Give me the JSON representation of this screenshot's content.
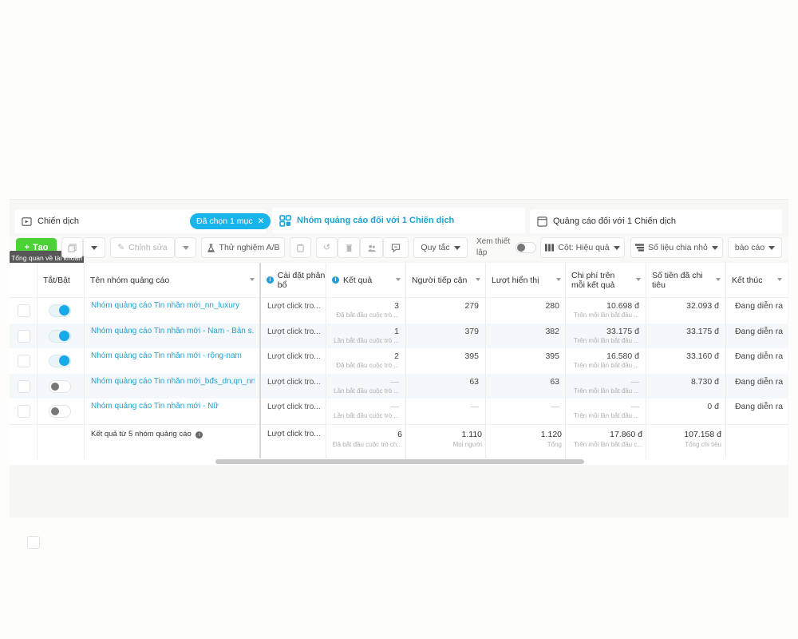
{
  "tabs": {
    "campaigns": "Chiến dịch",
    "selected_pill": "Đã chọn 1 mục",
    "adsets": "Nhóm quảng cáo đối với 1 Chiến dịch",
    "ads": "Quảng cáo đối với 1 Chiến dịch"
  },
  "toolbar": {
    "create": "Tạo",
    "tooltip": "Tổng quan về tài khoản",
    "edit": "Chỉnh sửa",
    "ab_test": "Thử nghiệm A/B",
    "rules": "Quy tắc",
    "view_setup": "Xem thiết lập",
    "columns": "Cột: Hiệu quả",
    "breakdown": "Số liệu chia nhỏ",
    "reports": "báo cáo"
  },
  "headers": {
    "toggle": "Tắt/Bật",
    "name": "Tên nhóm quảng cáo",
    "delivery": "Cài đặt phân bổ",
    "results": "Kết quả",
    "reach": "Người tiếp cận",
    "impressions": "Lượt hiển thị",
    "cost_per_result": "Chi phí trên mỗi kết quả",
    "amount_spent": "Số tiền đã chi tiêu",
    "ends": "Kết thúc"
  },
  "rows": [
    {
      "on": true,
      "name": "Nhóm quảng cáo Tin nhắn mới_nn_luxury",
      "delivery": "Lượt click tro...",
      "results": "3",
      "results_sub": "Đã bắt đầu cuộc trò ...",
      "reach": "279",
      "impressions": "280",
      "cpr": "10.698 đ",
      "cpr_sub": "Trên mỗi lần bắt đầu ...",
      "spent": "32.093 đ",
      "ends": "Đang diễn ra"
    },
    {
      "on": true,
      "name": "Nhóm quảng cáo Tin nhắn mới - Nam - Bản s...",
      "delivery": "Lượt click tro...",
      "results": "1",
      "results_sub": "Lần bắt đầu cuộc trò ...",
      "reach": "379",
      "impressions": "382",
      "cpr": "33.175 đ",
      "cpr_sub": "Trên mỗi lần bắt đầu ...",
      "spent": "33.175 đ",
      "ends": "Đang diễn ra"
    },
    {
      "on": true,
      "name": "Nhóm quảng cáo Tin nhắn mới - rộng-nam",
      "delivery": "Lượt click tro...",
      "results": "2",
      "results_sub": "Đã bắt đầu cuộc trò ...",
      "reach": "395",
      "impressions": "395",
      "cpr": "16.580 đ",
      "cpr_sub": "Trên mỗi lần bắt đầu ...",
      "spent": "33.160 đ",
      "ends": "Đang diễn ra"
    },
    {
      "on": false,
      "name": "Nhóm quảng cáo Tin nhắn mới_bđs_dn,qn_nn",
      "delivery": "Lượt click tro...",
      "results": "—",
      "results_sub": "Lần bắt đầu cuộc trò ...",
      "reach": "63",
      "impressions": "63",
      "cpr": "—",
      "cpr_sub": "Trên mỗi lần bắt đầu ...",
      "spent": "8.730 đ",
      "ends": "Đang diễn ra"
    },
    {
      "on": false,
      "name": "Nhóm quảng cáo Tin nhắn mới - Nữ",
      "delivery": "Lượt click tro...",
      "results": "—",
      "results_sub": "Lần bắt đầu cuộc trò ...",
      "reach": "—",
      "impressions": "—",
      "cpr": "—",
      "cpr_sub": "Trên mỗi lần bắt đầu ...",
      "spent": "0 đ",
      "ends": "Đang diễn ra"
    }
  ],
  "totals": {
    "label": "Kết quả từ 5 nhóm quảng cáo",
    "delivery": "Lượt click tro...",
    "results": "6",
    "results_sub": "Đã bắt đầu cuộc trò ch...",
    "reach": "1.110",
    "reach_sub": "Mọi người",
    "impressions": "1.120",
    "impressions_sub": "Tổng",
    "cpr": "17.860 đ",
    "cpr_sub": "Trên mỗi lần bắt đầu c...",
    "spent": "107.158 đ",
    "spent_sub": "Tổng chi tiêu"
  },
  "colors": {
    "accent": "#18b4ec",
    "create": "#4cd137",
    "link": "#1aa3d4"
  }
}
